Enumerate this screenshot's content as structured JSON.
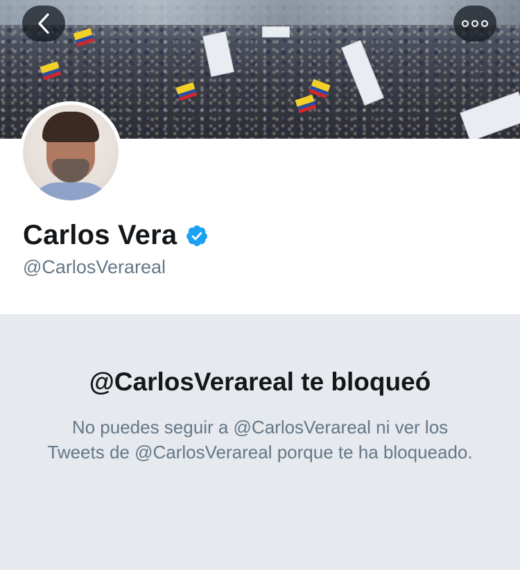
{
  "header": {
    "back_icon": "chevron-left-icon",
    "more_icon": "more-options-icon"
  },
  "profile": {
    "name": "Carlos Vera",
    "verified_icon": "verified-badge-icon",
    "verified_color": "#1da1f2",
    "handle": "@CarlosVerareal"
  },
  "blocked": {
    "title": "@CarlosVerareal te bloqueó",
    "message": "No puedes seguir a @CarlosVerareal ni ver los Tweets de @CarlosVerareal porque te ha bloqueado."
  },
  "colors": {
    "text_primary": "#14171a",
    "text_secondary": "#657786",
    "panel_bg": "#e6e9ee"
  }
}
